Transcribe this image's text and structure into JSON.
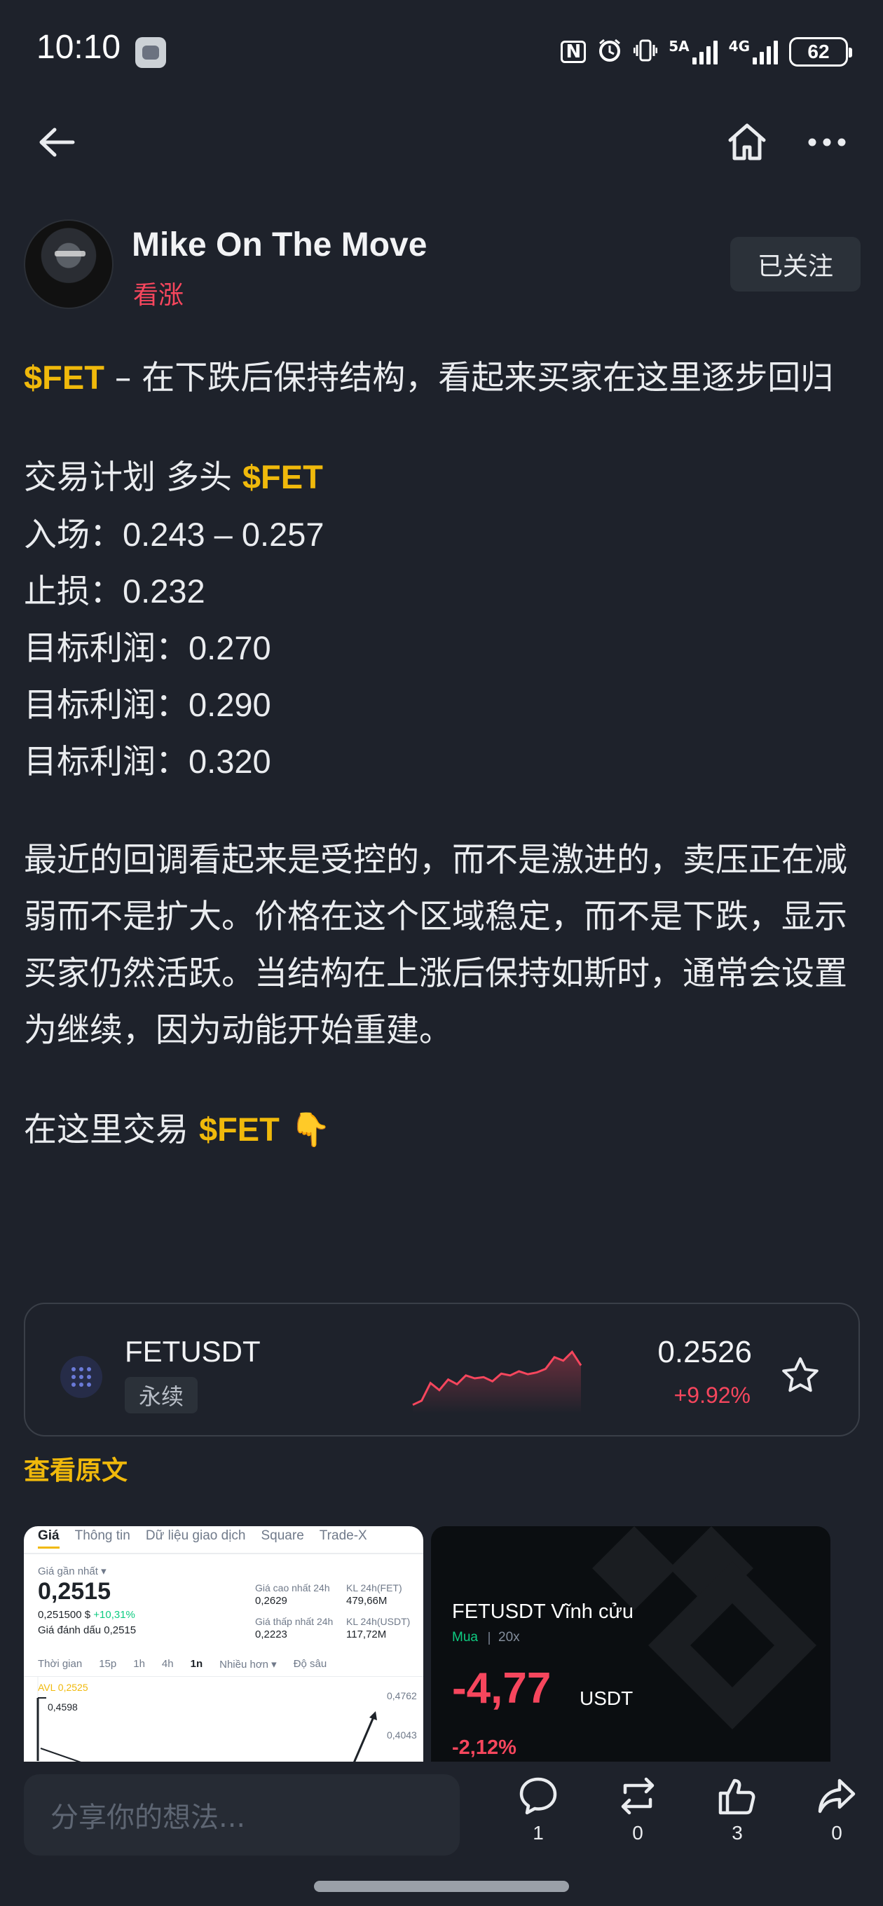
{
  "status_bar": {
    "time": "10:10",
    "nfc": "N",
    "net_label_1": "5A",
    "net_label_2": "4G",
    "battery": "62"
  },
  "author": {
    "name": "Mike On The Move",
    "sentiment": "看涨",
    "follow_label": "已关注"
  },
  "post": {
    "intro_tag": "$FET",
    "intro_text": " – 在下跌后保持结构，看起来买家在这里逐步回归",
    "plan_prefix": "交易计划 多头 ",
    "plan_tag": "$FET",
    "entry": "入场：0.243 – 0.257",
    "stop": "止损：0.232",
    "tp1": "目标利润：0.270",
    "tp2": "目标利润：0.290",
    "tp3": "目标利润：0.320",
    "analysis": "最近的回调看起来是受控的，而不是激进的，卖压正在减弱而不是扩大。价格在这个区域稳定，而不是下跌，显示买家仍然活跃。当结构在上涨后保持如斯时，通常会设置为继续，因为动能开始重建。",
    "cta_prefix": "在这里交易 ",
    "cta_tag": "$FET",
    "cta_emoji": "👇"
  },
  "coin_card": {
    "symbol": "FETUSDT",
    "tag": "永续",
    "price": "0.2526",
    "change": "+9.92%",
    "sparkline": [
      0.05,
      0.12,
      0.42,
      0.3,
      0.48,
      0.4,
      0.55,
      0.5,
      0.52,
      0.45,
      0.58,
      0.55,
      0.62,
      0.57,
      0.6,
      0.66,
      0.86,
      0.8,
      0.95,
      0.72
    ]
  },
  "view_original_label": "查看原文",
  "image1": {
    "tabs": [
      "Giá",
      "Thông tin",
      "Dữ liệu giao dịch",
      "Square",
      "Trade-X"
    ],
    "last_price_label": "Giá gần nhất ▾",
    "last_price": "0,2515",
    "sub_price": "0,251500 $",
    "sub_change": "+10,31%",
    "mark_label": "Giá đánh dấu 0,2515",
    "high_label": "Giá cao nhất 24h",
    "high_value": "0,2629",
    "low_label": "Giá thấp nhất 24h",
    "low_value": "0,2223",
    "vol_fet_label": "KL 24h(FET)",
    "vol_fet_value": "479,66M",
    "vol_usdt_label": "KL 24h(USDT)",
    "vol_usdt_value": "117,72M",
    "timeframes": [
      "Thời gian",
      "15p",
      "1h",
      "4h",
      "1n",
      "Nhiều hơn ▾",
      "Độ sâu"
    ],
    "active_timeframe": "1n",
    "avl": "AVL 0,2525",
    "marker_high": "0,4598",
    "axis_top": "0,4762",
    "axis_mid": "0,4043"
  },
  "image2": {
    "title": "FETUSDT Vĩnh cửu",
    "side": "Mua",
    "leverage": "20x",
    "pnl": "-4,77",
    "pnl_unit": "USDT",
    "pnl_pct": "-2,12%"
  },
  "bottom_bar": {
    "placeholder": "分享你的想法...",
    "comments": "1",
    "reposts": "0",
    "likes": "3",
    "shares": "0"
  },
  "colors": {
    "background": "#1e222b",
    "accent": "#f0b90b",
    "bearish": "#f6465d",
    "bullish": "#0ecb81"
  }
}
